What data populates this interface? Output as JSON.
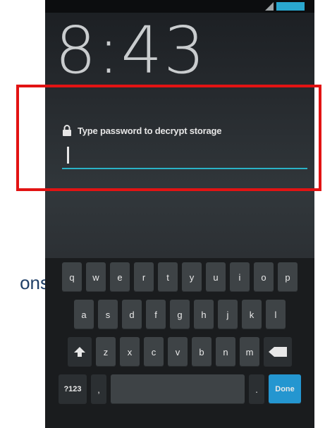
{
  "side_label": "ons",
  "status_bar": {
    "signal": "signal-icon",
    "battery": "battery-icon"
  },
  "lock_screen": {
    "time": "8:43",
    "prompt": "Type password to decrypt storage",
    "password_value": ""
  },
  "keyboard": {
    "row1": [
      "q",
      "w",
      "e",
      "r",
      "t",
      "y",
      "u",
      "i",
      "o",
      "p"
    ],
    "row2": [
      "a",
      "s",
      "d",
      "f",
      "g",
      "h",
      "j",
      "k",
      "l"
    ],
    "row3": [
      "z",
      "x",
      "c",
      "v",
      "b",
      "n",
      "m"
    ],
    "symbols_label": "?123",
    "comma_label": ",",
    "period_label": ".",
    "done_label": "Done"
  },
  "colors": {
    "accent": "#2ab3c7",
    "highlight": "#e21313",
    "side_text": "#1f3f67"
  }
}
